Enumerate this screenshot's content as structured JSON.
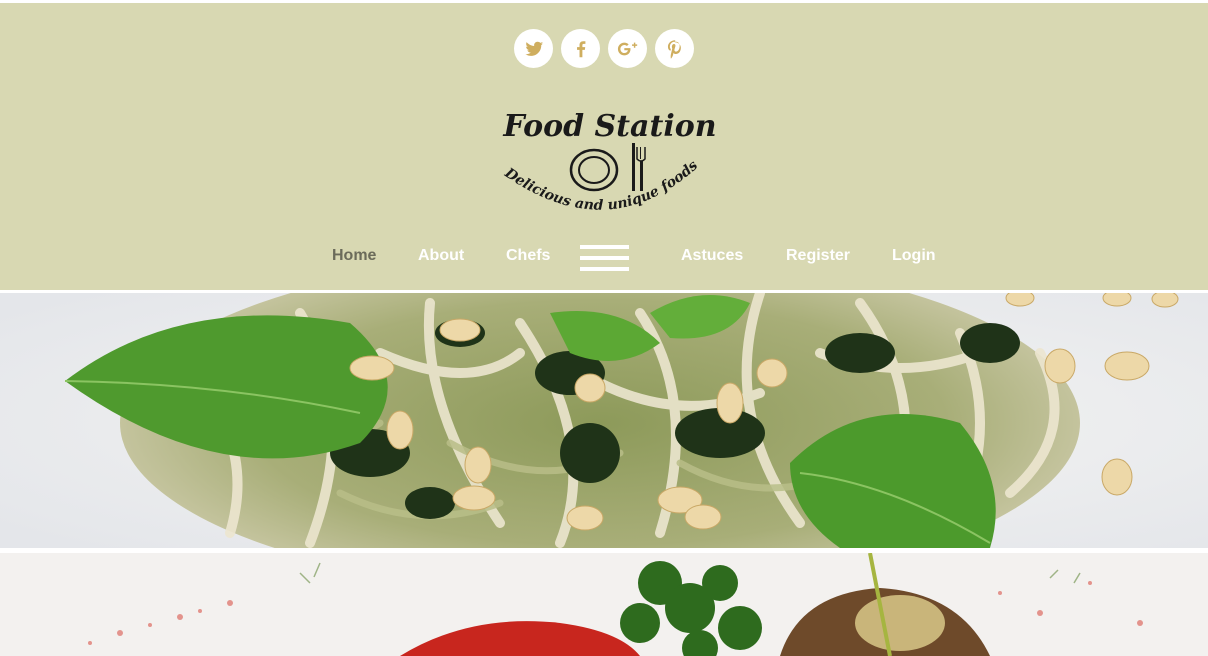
{
  "social": {
    "items": [
      {
        "name": "twitter",
        "glyph": "🐦"
      },
      {
        "name": "facebook",
        "glyph": "f"
      },
      {
        "name": "google-plus",
        "glyph": "g+"
      },
      {
        "name": "pinterest",
        "glyph": "p"
      }
    ]
  },
  "logo": {
    "title": "Food Station",
    "tagline": "Delicious and unique foods"
  },
  "nav": {
    "home": "Home",
    "about": "About",
    "chefs": "Chefs",
    "menu_icon": "hamburger-menu-icon",
    "astuces": "Astuces",
    "register": "Register",
    "login": "Login"
  },
  "colors": {
    "header_bg": "#d8d8b2",
    "nav_active": "#6b6b5a",
    "nav_text": "#ffffff",
    "social_icon": "#cfae5f"
  },
  "banners": [
    {
      "name": "pesto-pasta-banner"
    },
    {
      "name": "grilled-dish-banner"
    }
  ]
}
